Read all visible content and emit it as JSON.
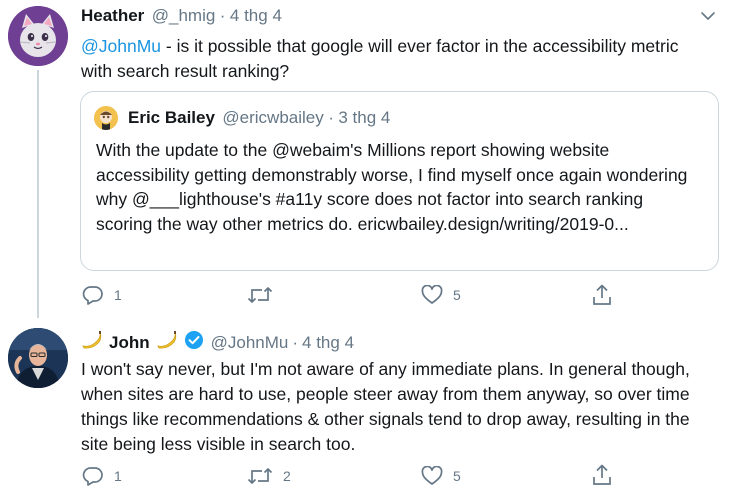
{
  "tweet1": {
    "display_name": "Heather",
    "handle": "@_hmig",
    "separator": "·",
    "date": "4 thg 4",
    "mention": "@JohnMu",
    "text_rest": " - is it possible that google will ever factor in the accessibility metric with search result ranking?",
    "quote": {
      "display_name": "Eric Bailey",
      "handle": "@ericwbailey",
      "separator": "·",
      "date": "3 thg 4",
      "text": "With the update to the @webaim's Millions report showing website accessibility getting demonstrably worse, I find myself once again wondering why @___lighthouse's #a11y score does not factor into search ranking scoring the way other metrics do.",
      "link": "ericwbailey.design/writing/2019-0..."
    },
    "actions": {
      "reply_count": "1",
      "retweet_count": "",
      "like_count": "5"
    }
  },
  "tweet2": {
    "display_name": "John",
    "handle": "@JohnMu",
    "separator": "·",
    "date": "4 thg 4",
    "text": "I won't say never, but I'm not aware of any immediate plans. In general though, when sites are hard to use, people steer away from them anyway, so over time things like recommendations & other signals tend to drop away, resulting in the site being less visible in search too.",
    "actions": {
      "reply_count": "1",
      "retweet_count": "2",
      "like_count": "5"
    }
  },
  "icons": [
    "cat-avatar",
    "chevron-down-icon",
    "reply-icon",
    "retweet-icon",
    "like-icon",
    "share-icon",
    "banana-emoji-icon",
    "verified-badge-icon"
  ],
  "colors": {
    "link": "#1b95e0",
    "muted": "#657786",
    "verified": "#1da1f2",
    "thread_line": "#ccd6dd"
  }
}
